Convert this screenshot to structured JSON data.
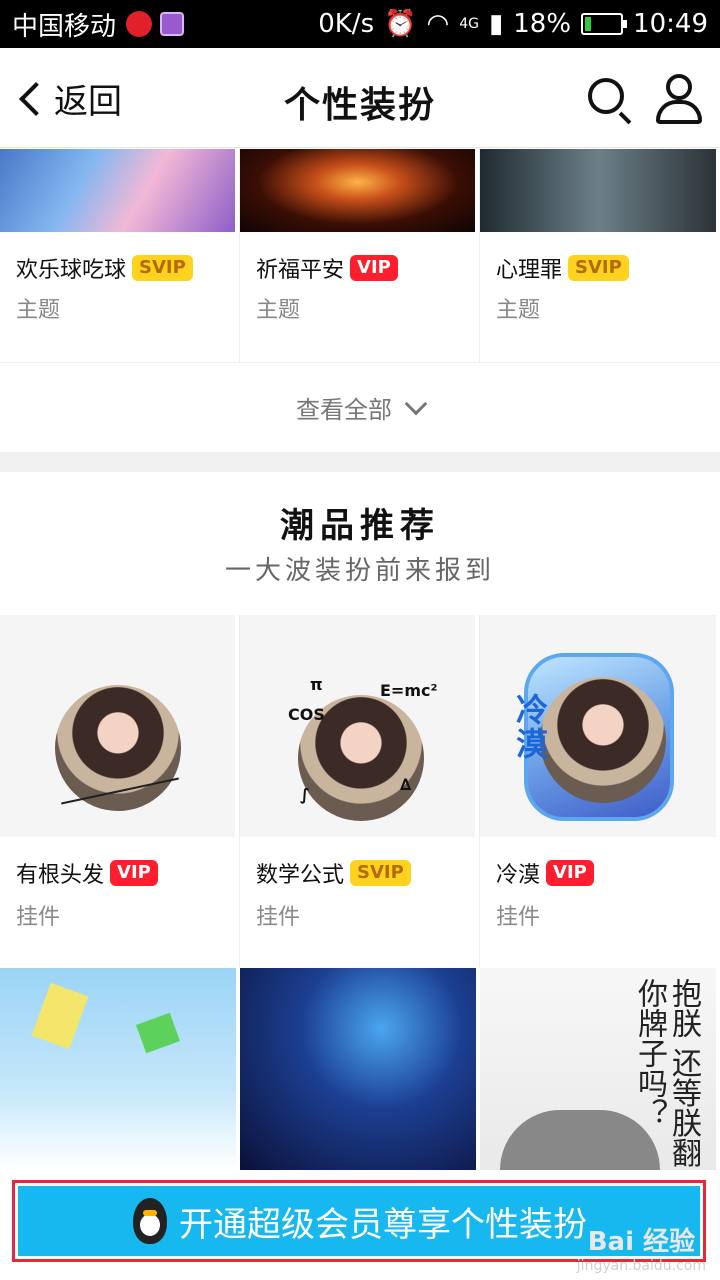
{
  "status_bar": {
    "carrier": "中国移动",
    "speed": "0K/s",
    "network": "4G",
    "battery_percent": "18%",
    "battery_level": 0.18,
    "time": "10:49"
  },
  "nav": {
    "back_label": "返回",
    "title": "个性装扮"
  },
  "themes": [
    {
      "name": "欢乐球吃球",
      "badge": "SVIP",
      "type": "主题"
    },
    {
      "name": "祈福平安",
      "badge": "VIP",
      "type": "主题"
    },
    {
      "name": "心理罪",
      "badge": "SVIP",
      "type": "主题"
    }
  ],
  "view_all": "查看全部",
  "section": {
    "title": "潮品推荐",
    "subtitle": "一大波装扮前来报到"
  },
  "pendants": [
    {
      "name": "有根头发",
      "badge": "VIP",
      "type": "挂件"
    },
    {
      "name": "数学公式",
      "badge": "SVIP",
      "type": "挂件"
    },
    {
      "name": "冷漠",
      "badge": "VIP",
      "type": "挂件"
    }
  ],
  "pendant_art": {
    "math_terms": [
      "π",
      "E=mc²",
      "COS",
      "∫",
      "∆"
    ],
    "cold_text": "冷漠"
  },
  "bottom_art": {
    "calligraphy": "抱朕 还等朕翻你牌子吗？"
  },
  "banner": {
    "label": "开通超级会员尊享个性装扮"
  },
  "watermark": {
    "brand": "Bai 经验",
    "url": "jingyan.baidu.com"
  },
  "colors": {
    "vip": "#ff1e2d",
    "svip": "#ffd21e",
    "banner": "#17b8f0",
    "highlight_border": "#e8283a"
  }
}
